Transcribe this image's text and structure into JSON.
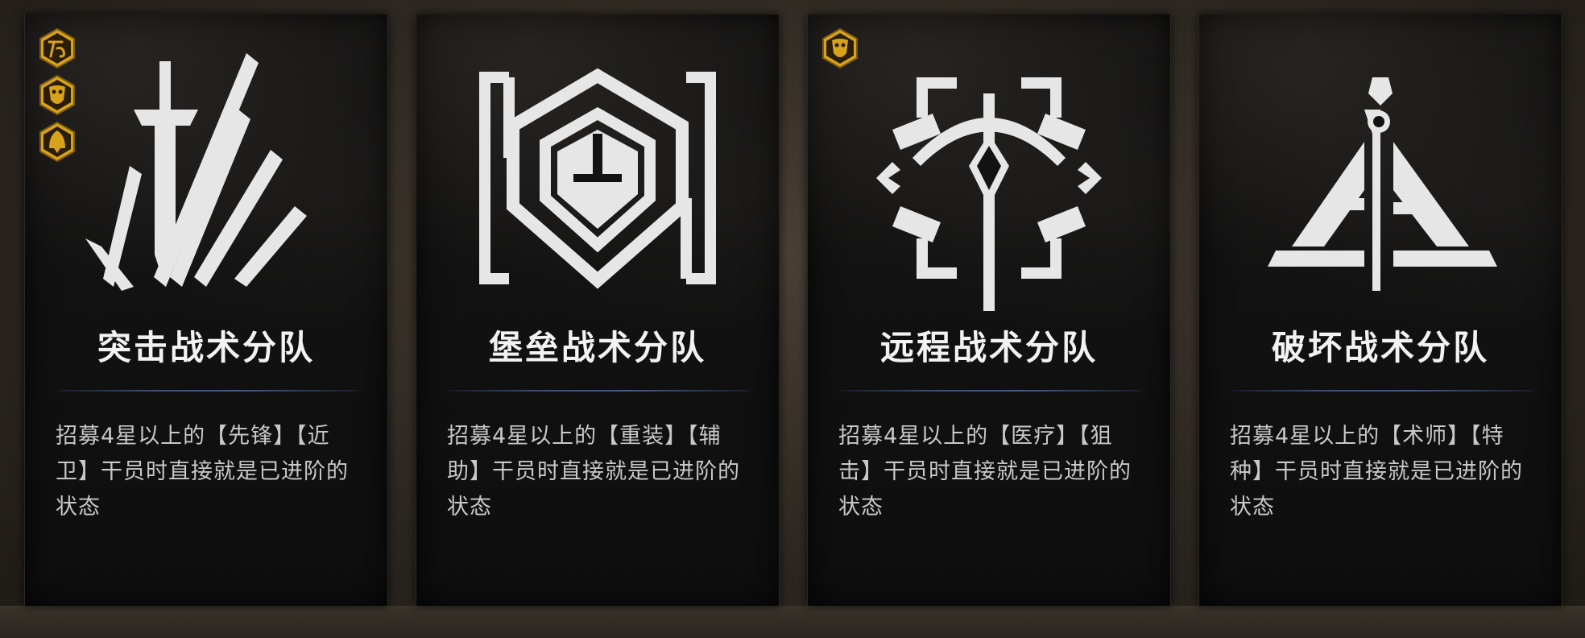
{
  "cards": [
    {
      "title": "突击战术分队",
      "desc": "招募4星以上的【先锋】【近卫】干员时直接就是已进阶的状态",
      "emblem": "sword-icon",
      "badges": [
        "ink-badge-icon",
        "mask-badge-icon",
        "bell-badge-icon"
      ]
    },
    {
      "title": "堡垒战术分队",
      "desc": "招募4星以上的【重装】【辅助】干员时直接就是已进阶的状态",
      "emblem": "shield-icon",
      "badges": []
    },
    {
      "title": "远程战术分队",
      "desc": "招募4星以上的【医疗】【狙击】干员时直接就是已进阶的状态",
      "emblem": "crossbow-icon",
      "badges": [
        "mask-badge-icon"
      ]
    },
    {
      "title": "破坏战术分队",
      "desc": "招募4星以上的【术师】【特种】干员时直接就是已进阶的状态",
      "emblem": "triangle-staff-icon",
      "badges": []
    }
  ],
  "colors": {
    "badge_gold": "#d9a21c",
    "emblem": "#e6e6e6",
    "divider": "#4a5a82"
  }
}
